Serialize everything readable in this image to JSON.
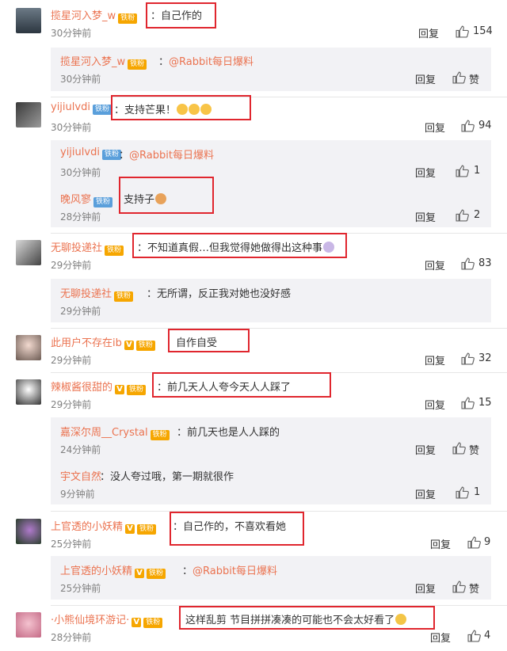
{
  "labels": {
    "reply": "回复",
    "like": "赞"
  },
  "colors": {
    "username": "#eb7350",
    "highlight_border": "#e0262e",
    "reply_bg": "#f2f2f5",
    "badge_gold": "#f6a600",
    "badge_blue": "#5a9fdb"
  },
  "fan_badge_text": "铁粉",
  "comments": [
    {
      "user": "揽星河入梦_w",
      "text": "自己作的",
      "time": "30分钟前",
      "likes": "154",
      "replies": [
        {
          "user": "揽星河入梦_w",
          "text": "@Rabbit每日爆料",
          "time": "30分钟前",
          "likes": "赞"
        }
      ]
    },
    {
      "user": "yijiulvdi",
      "text": "支持芒果！",
      "time": "30分钟前",
      "likes": "94",
      "replies": [
        {
          "user": "yijiulvdi",
          "text": "@Rabbit每日爆料",
          "time": "30分钟前",
          "likes": "1"
        },
        {
          "user": "晚风寥",
          "text": "支持子",
          "time": "28分钟前",
          "likes": "2"
        }
      ]
    },
    {
      "user": "无聊投递社",
      "text": "不知道真假…但我觉得她做得出这种事",
      "time": "29分钟前",
      "likes": "83",
      "replies": [
        {
          "user": "无聊投递社",
          "text": "无所谓，反正我对她也没好感",
          "time": "29分钟前",
          "likes": ""
        }
      ]
    },
    {
      "user": "此用户不存在ib",
      "text": "自作自受",
      "time": "29分钟前",
      "likes": "32",
      "replies": []
    },
    {
      "user": "辣椒酱很甜的",
      "text": "前几天人人夸今天人人踩了",
      "time": "29分钟前",
      "likes": "15",
      "replies": [
        {
          "user": "嘉深尔周__Crystal",
          "text": "前几天也是人人踩的",
          "time": "24分钟前",
          "likes": "赞"
        },
        {
          "user": "宇文自然",
          "text": "没人夸过哦，第一期就很作",
          "time": "9分钟前",
          "likes": "1"
        }
      ]
    },
    {
      "user": "上官透的小妖精",
      "text": "自己作的，不喜欢看她",
      "time": "25分钟前",
      "likes": "9",
      "replies": [
        {
          "user": "上官透的小妖精",
          "text": "@Rabbit每日爆料",
          "time": "25分钟前",
          "likes": "赞"
        }
      ]
    },
    {
      "user": "·小熊仙境环游记·",
      "text": "这样乱剪 节目拼拼凑凑的可能也不会太好看了",
      "time": "28分钟前",
      "likes": "4",
      "replies": []
    }
  ]
}
